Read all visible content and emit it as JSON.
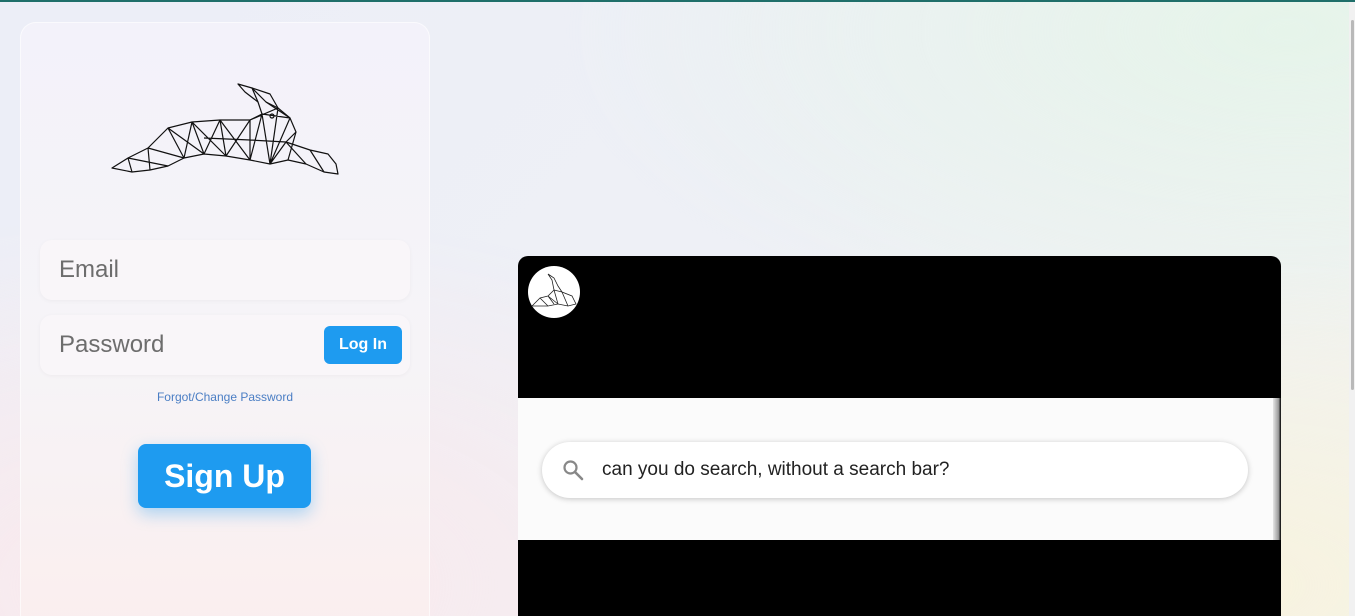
{
  "login": {
    "email_placeholder": "Email",
    "password_placeholder": "Password",
    "login_label": "Log In",
    "forgot_label": "Forgot/Change Password",
    "signup_label": "Sign Up"
  },
  "video": {
    "search_query": "can you do search, without a search bar?"
  },
  "icons": {
    "logo": "geometric-rabbit-logo",
    "avatar": "rabbit-avatar",
    "search": "search-icon"
  },
  "colors": {
    "accent": "#1e9bf0",
    "link": "#4a7ec4",
    "top_line": "#1f6f6a"
  }
}
